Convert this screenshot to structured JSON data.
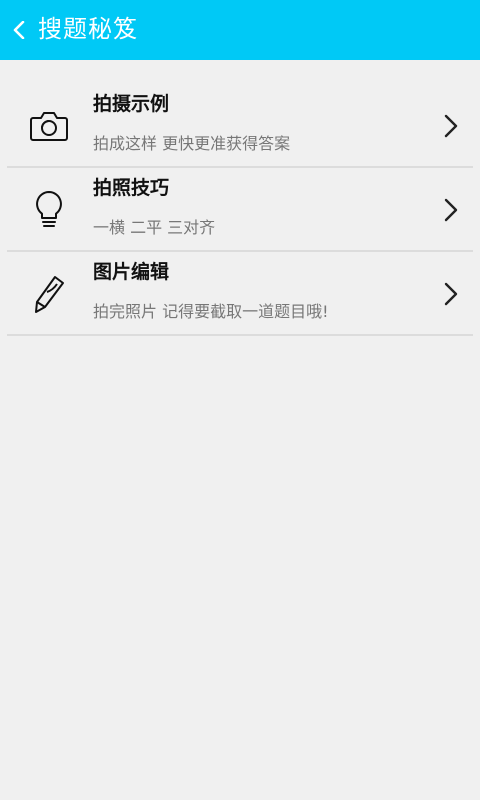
{
  "header": {
    "title": "搜题秘笈",
    "back_icon": "chevron-left-icon"
  },
  "items": [
    {
      "title": "拍摄示例",
      "subtitle": "拍成这样 更快更准获得答案",
      "icon": "camera-icon"
    },
    {
      "title": "拍照技巧",
      "subtitle": "一横 二平 三对齐",
      "icon": "lightbulb-icon"
    },
    {
      "title": "图片编辑",
      "subtitle": "拍完照片 记得要截取一道题目哦!",
      "icon": "pencil-icon"
    }
  ],
  "colors": {
    "header_bg": "#00c9f6",
    "page_bg": "#f0f0f0",
    "divider": "#dcdcdc"
  }
}
